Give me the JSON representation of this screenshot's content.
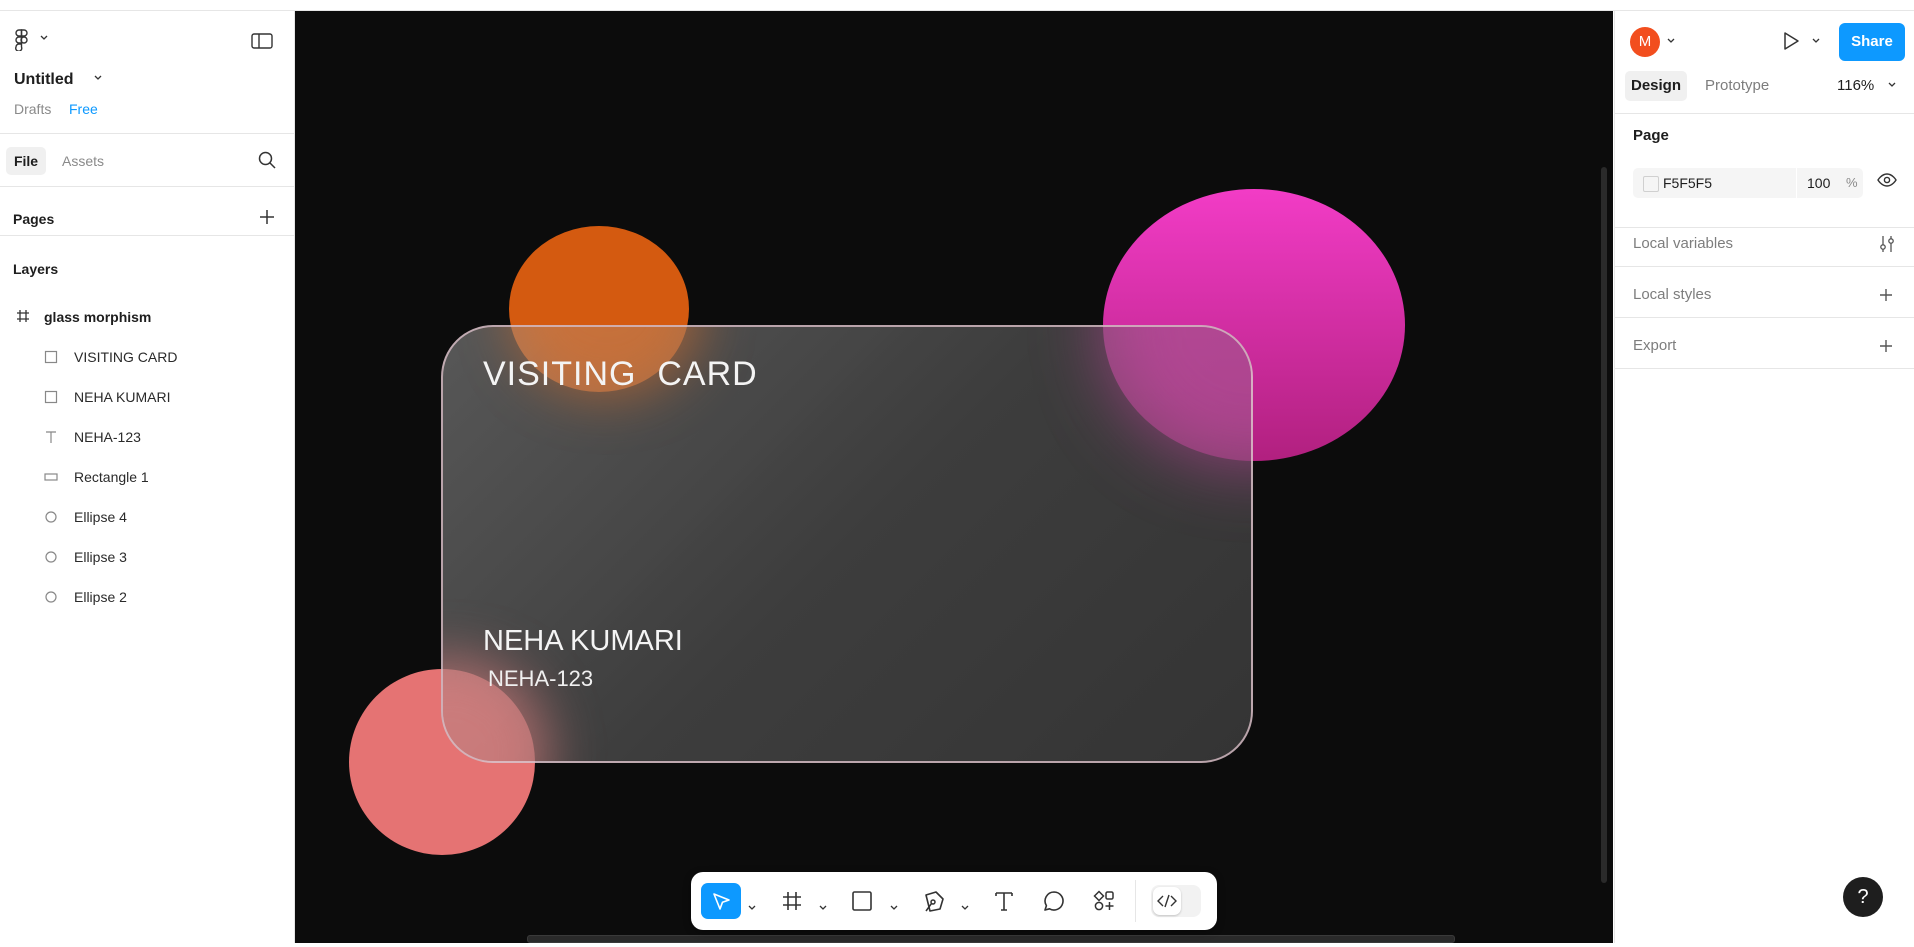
{
  "file": {
    "title": "Untitled",
    "location": "Drafts",
    "plan": "Free"
  },
  "left_tabs": {
    "file": "File",
    "assets": "Assets"
  },
  "pages": {
    "label": "Pages"
  },
  "layers": {
    "label": "Layers",
    "frame": "glass morphism",
    "items": [
      {
        "label": "VISITING CARD",
        "icon": "rectangle-outline-icon"
      },
      {
        "label": "NEHA KUMARI",
        "icon": "rectangle-outline-icon"
      },
      {
        "label": "NEHA-123",
        "icon": "text-icon"
      },
      {
        "label": "Rectangle 1",
        "icon": "rectangle-icon"
      },
      {
        "label": "Ellipse 4",
        "icon": "ellipse-icon"
      },
      {
        "label": "Ellipse 3",
        "icon": "ellipse-icon"
      },
      {
        "label": "Ellipse 2",
        "icon": "ellipse-icon"
      }
    ]
  },
  "canvas": {
    "card_title": "VISITING  CARD",
    "card_name": "NEHA KUMARI",
    "card_id": "NEHA-123",
    "background_color": "#0c0c0c",
    "circle_colors": {
      "orange": "#d45a10",
      "pink": "#f23cc6",
      "coral": "#e57373"
    }
  },
  "toolbar": {
    "tools": [
      "move-tool",
      "frame-tool",
      "rectangle-tool",
      "pen-tool",
      "text-tool",
      "comment-tool",
      "actions-tool",
      "dev-mode-toggle"
    ],
    "active_tool": "move-tool"
  },
  "right": {
    "avatar_initial": "M",
    "share": "Share",
    "tab_design": "Design",
    "tab_prototype": "Prototype",
    "zoom": "116%",
    "page_label": "Page",
    "page_color": "F5F5F5",
    "page_opacity": "100",
    "percent_sign": "%",
    "local_variables": "Local variables",
    "local_styles": "Local styles",
    "export": "Export",
    "help": "?"
  },
  "colors": {
    "accent": "#0d99ff",
    "avatar": "#f24e1e"
  }
}
